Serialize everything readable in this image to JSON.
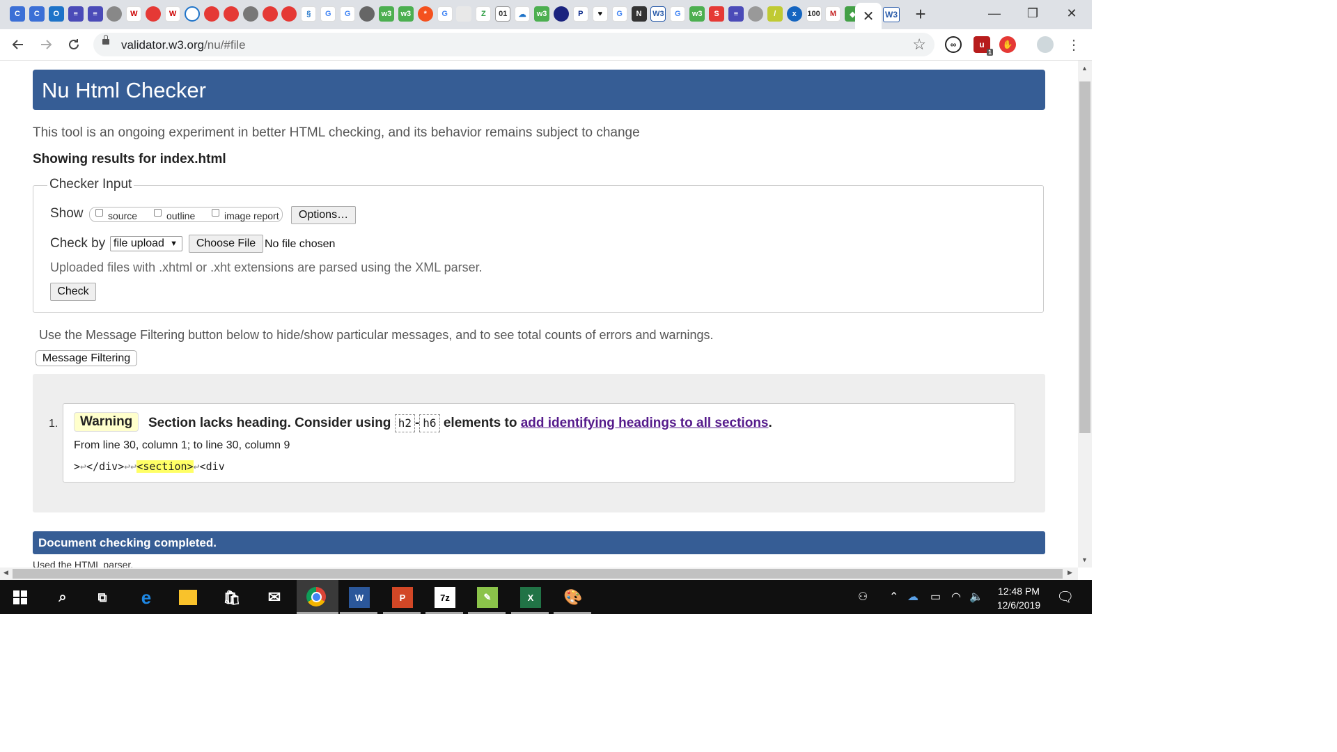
{
  "browser": {
    "tab_close_glyph": "✕",
    "new_tab_glyph": "+",
    "url_host": "validator.w3.org",
    "url_path": "/nu/#file",
    "extension_badge": "1",
    "window_controls": {
      "minimize": "—",
      "restore": "❐",
      "close": "✕"
    }
  },
  "page": {
    "header_title": "Nu Html Checker",
    "intro": "This tool is an ongoing experiment in better HTML checking, and its behavior remains subject to change",
    "showing_results": "Showing results for index.html",
    "checker_input": {
      "legend": "Checker Input",
      "show_label": "Show",
      "show_options": [
        "source",
        "outline",
        "image report"
      ],
      "options_button": "Options…",
      "check_by_label": "Check by",
      "check_by_value": "file upload",
      "choose_file_button": "Choose File",
      "no_file_text": "No file chosen",
      "upload_note": "Uploaded files with .xhtml or .xht extensions are parsed using the XML parser.",
      "check_button": "Check"
    },
    "filter_note": "Use the Message Filtering button below to hide/show particular messages, and to see total counts of errors and warnings.",
    "message_filtering_button": "Message Filtering",
    "messages": [
      {
        "number": "1.",
        "type": "Warning",
        "text_before": "Section lacks heading. Consider using",
        "code_1": "h2",
        "dash": "-",
        "code_2": "h6",
        "text_mid": "elements to",
        "link_text": "add identifying headings to all sections",
        "text_end": ".",
        "location": "From line 30, column 1; to line 30, column 9",
        "extract_before": ">",
        "extract_lf1": "↩",
        "extract_mid": "</div>",
        "extract_lf2": "↩↩",
        "extract_highlight": "<section>",
        "extract_lf3": "↩",
        "extract_after": "<div"
      }
    ],
    "completed": "Document checking completed.",
    "parser_note": "Used the HTML parser."
  },
  "taskbar": {
    "time": "12:48 PM",
    "date": "12/6/2019"
  },
  "colors": {
    "header_blue": "#365d95",
    "warning_bg": "#ffffcc",
    "highlight": "#ffff66",
    "link": "#551a8b"
  }
}
